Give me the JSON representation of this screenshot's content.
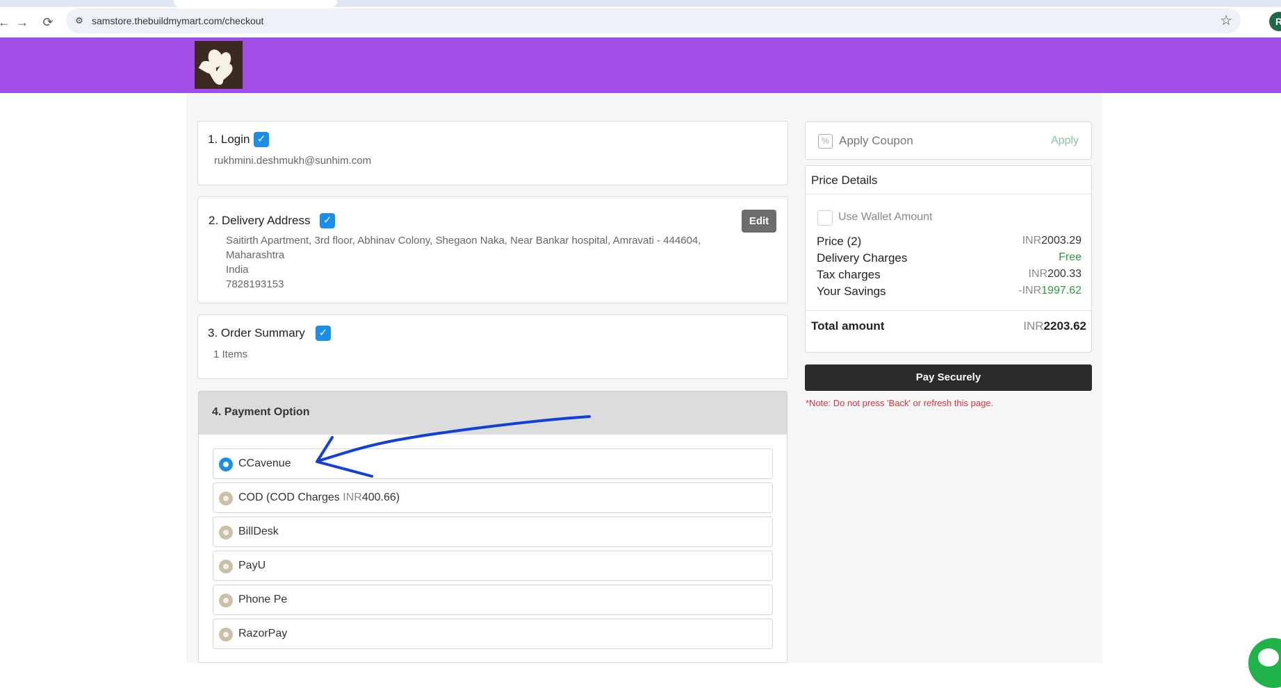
{
  "browser": {
    "url": "samstore.thebuildmymart.com/checkout",
    "profile_initial": "R",
    "icons": {
      "back": "back-arrow-icon",
      "forward": "forward-arrow-icon",
      "reload": "reload-icon",
      "site_info": "site-settings-icon",
      "bookmark": "star-icon"
    }
  },
  "header": {
    "logo": "flower-logo",
    "color": "#a04ee6"
  },
  "sections": {
    "login": {
      "title": "1. Login",
      "email": "rukhmini.deshmukh@sunhim.com"
    },
    "delivery": {
      "title": "2. Delivery Address",
      "edit_label": "Edit",
      "address_line1": "Saitirth Apartment, 3rd floor, Abhinav Colony, Shegaon Naka, Near Bankar hospital, Amravati - 444604,",
      "address_line2": "Maharashtra",
      "country": "India",
      "phone": "7828193153"
    },
    "order_summary": {
      "title": "3. Order Summary",
      "items": "1 Items"
    },
    "payment": {
      "title": "4. Payment Option",
      "options": [
        {
          "label": "CCavenue",
          "selected": true
        },
        {
          "label": "COD (COD Charges ",
          "currency": "INR",
          "amount": "400.66",
          "suffix": ")",
          "selected": false
        },
        {
          "label": "BillDesk",
          "selected": false
        },
        {
          "label": "PayU",
          "selected": false
        },
        {
          "label": "Phone Pe",
          "selected": false
        },
        {
          "label": "RazorPay",
          "selected": false
        }
      ]
    }
  },
  "coupon": {
    "label": "Apply Coupon",
    "apply": "Apply"
  },
  "price_details": {
    "title": "Price Details",
    "wallet_label": "Use Wallet Amount",
    "price_label": "Price (2)",
    "price_currency": "INR",
    "price_value": "2003.29",
    "delivery_label": "Delivery Charges",
    "delivery_value": "Free",
    "tax_label": "Tax charges",
    "tax_currency": "INR",
    "tax_value": "200.33",
    "savings_label": "Your Savings",
    "savings_prefix": "-INR",
    "savings_value": "1997.62",
    "total_label": "Total amount",
    "total_currency": "INR",
    "total_value": "2203.62"
  },
  "pay_button": "Pay Securely",
  "note": "*Note: Do not press 'Back' or refresh this page.",
  "colors": {
    "accent": "#1a8ee8",
    "header": "#a04ee6",
    "green": "#2e9b3b",
    "note": "#d9323c",
    "annotation_arrow": "#1140d8"
  }
}
